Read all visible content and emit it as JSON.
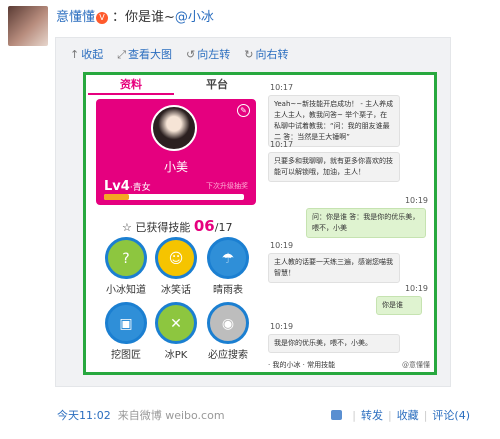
{
  "post": {
    "username": "意懂懂",
    "text_prefix": "：你是谁~",
    "mention": "@小冰",
    "vip_icon": "vip-badge-icon"
  },
  "toolbar": {
    "collapse": "收起",
    "view_large": "查看大图",
    "rotate_left": "向左转",
    "rotate_right": "向右转"
  },
  "app": {
    "tabs": [
      "资料",
      "平台"
    ],
    "card": {
      "name": "小美",
      "level_prefix": "Lv",
      "level": "4",
      "level_title": "·青女",
      "next_hint": "下次升级抽奖",
      "progress": 0.18
    },
    "skills": {
      "title": "已获得技能",
      "count": "06",
      "total": "/17",
      "items": [
        {
          "label": "小冰知道",
          "color": "#8dc63f",
          "glyph": "?"
        },
        {
          "label": "冰笑话",
          "color": "#f5c400",
          "glyph": "☺"
        },
        {
          "label": "晴雨表",
          "color": "#2f8fd8",
          "glyph": "☂"
        },
        {
          "label": "挖图匠",
          "color": "#2f8fd8",
          "glyph": "▣"
        },
        {
          "label": "冰PK",
          "color": "#8dc63f",
          "glyph": "✕"
        },
        {
          "label": "必应搜索",
          "color": "#bdbdbd",
          "glyph": "◉"
        }
      ]
    },
    "chat": [
      {
        "time": "10:17",
        "side": "left",
        "text": "Yeah~~新技能开启成功！ - 主人养成 主人主人，教我问答~ 举个栗子，在私聊中试着教我：“问：我的朋友谁最二 答：当然是王大锤啊”"
      },
      {
        "time": "10:17",
        "side": "left",
        "text": "只要多和我聊聊，就有更多你喜欢的技能可以解锁哦，加油，主人！"
      },
      {
        "time": "10:19",
        "side": "right",
        "text": "问：你是谁 答：我是你的优乐美，喂不，小美"
      },
      {
        "time": "10:19",
        "side": "left",
        "text": "主人教的话要一天练三遍，感谢您喵我智慧！"
      },
      {
        "time": "10:19",
        "side": "right",
        "text": "你是谁"
      },
      {
        "time": "10:19",
        "side": "left",
        "text": "我是你的优乐美，喂不，小美。"
      }
    ],
    "bottom_tabs": "· 我的小冰    · 常用技能",
    "watermark": "@意懂懂"
  },
  "meta": {
    "time": "今天11:02",
    "source": "来自微博 weibo.com"
  },
  "actions": {
    "repost": "转发",
    "favorite": "收藏",
    "comment": "评论(4)"
  }
}
